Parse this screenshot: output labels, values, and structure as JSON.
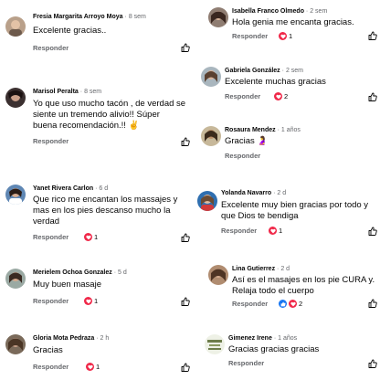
{
  "left": [
    {
      "name": "Fresia Margarita Arroyo Moya",
      "time": "8 sem",
      "lines": [
        "Excelente  gracias.."
      ],
      "reply": "Responder",
      "reactions": ""
    },
    {
      "name": "Marisol Peralta",
      "time": "8 sem",
      "lines": [
        "Yo que uso mucho tacón ,  de verdad se",
        "siente un tremendo alivio!! Súper",
        "buena recomendación.!! ✌"
      ],
      "reply": "Responder",
      "reactions": ""
    },
    {
      "name": "Yanet Rivera Carlon",
      "time": "6 d",
      "lines": [
        "Que  rico me encantan  los massajes  y",
        "mas en los pies descanso mucho  la",
        "verdad"
      ],
      "reply": "Responder",
      "reactions": "1"
    },
    {
      "name": "Merielem Ochoa Gonzalez",
      "time": "5 d",
      "lines": [
        "Muy buen masaje"
      ],
      "reply": "Responder",
      "reactions": "1"
    },
    {
      "name": "Gloria Mota Pedraza",
      "time": "2 h",
      "lines": [
        "Gracias"
      ],
      "reply": "Responder",
      "reactions": "1"
    }
  ],
  "right": [
    {
      "name": "Isabella Franco Olmedo",
      "time": "2 sem",
      "lines": [
        "Hola genia me encanta gracias."
      ],
      "reply": "Responder",
      "reactions": "1"
    },
    {
      "name": "Gabriela González",
      "time": "2 sem",
      "lines": [
        "Excelente muchas gracias"
      ],
      "reply": "Responder",
      "reactions": "2"
    },
    {
      "name": "Rosaura Mendez",
      "time": "1 años",
      "lines": [
        "Gracias 🤰"
      ],
      "reply": "Responder",
      "reactions": ""
    },
    {
      "name": "Yolanda Navarro",
      "time": "2 d",
      "lines": [
        "Excelente muy bien gracias por todo y",
        "que Dios te bendiga"
      ],
      "reply": "Responder",
      "reactions": "1"
    },
    {
      "name": "Lina Gutierrez",
      "time": "2 d",
      "lines": [
        "Así es el masajes  en los pie CURA y.",
        "Relaja todo el cuerpo"
      ],
      "reply": "Responder",
      "reactions": "2"
    },
    {
      "name": "Gimenez Irene",
      "time": "1 años",
      "lines": [
        "Gracias gracias gracias"
      ],
      "reply": "Responder",
      "reactions": ""
    }
  ],
  "separator": "·",
  "colors": {
    "heart": "#f02849",
    "like": "#1877f2",
    "muted": "#65676b"
  },
  "icons": {
    "like": "thumbs-up-outline-icon",
    "heart": "heart-reaction-icon",
    "thumb": "like-reaction-icon"
  }
}
